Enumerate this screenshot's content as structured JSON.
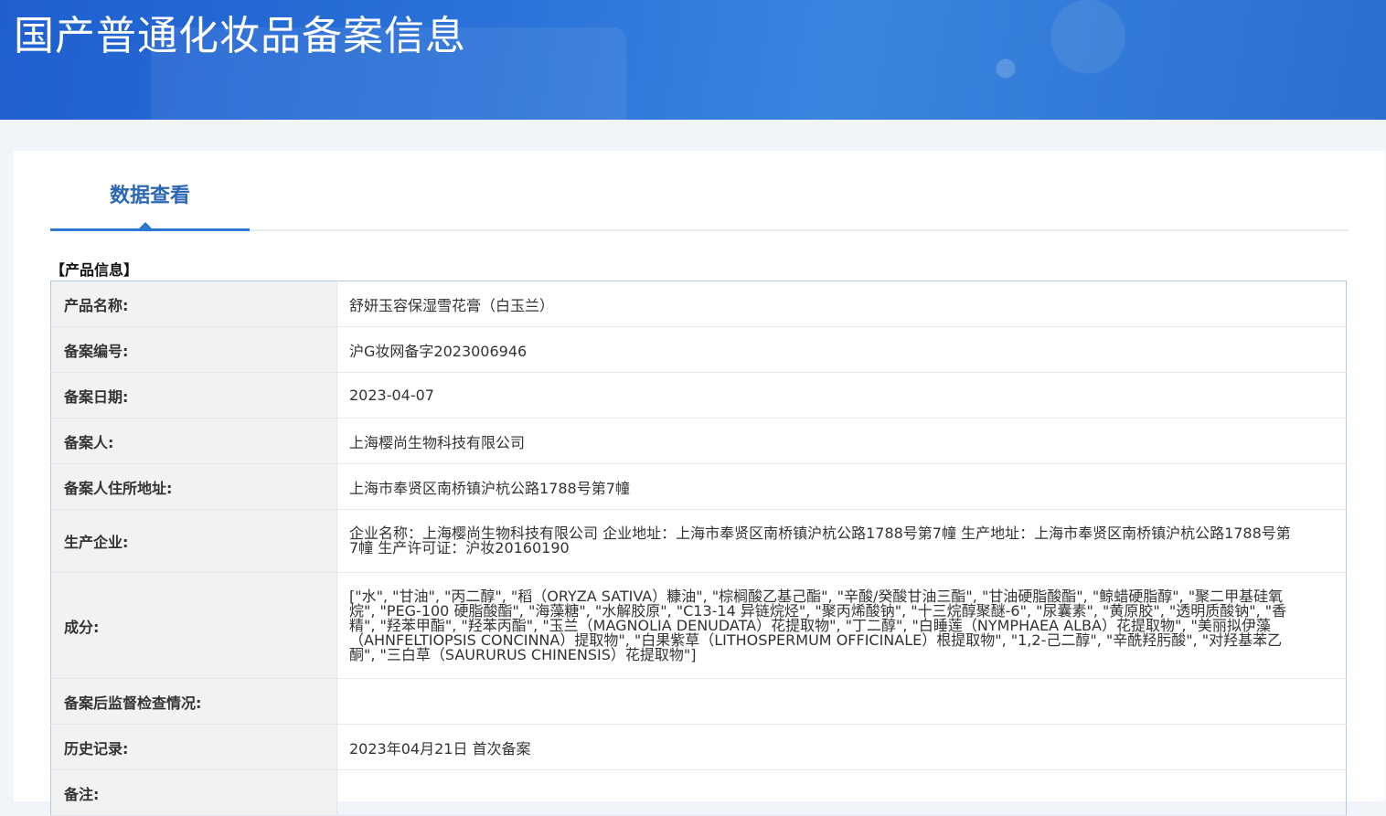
{
  "banner": {
    "title": "国产普通化妆品备案信息"
  },
  "tabs": {
    "active_label": "数据查看"
  },
  "section": {
    "title": "【产品信息】"
  },
  "rows": [
    {
      "label": "产品名称:",
      "value": "舒妍玉容保湿雪花膏（白玉兰）"
    },
    {
      "label": "备案编号:",
      "value": "沪G妆网备字2023006946"
    },
    {
      "label": "备案日期:",
      "value": "2023-04-07"
    },
    {
      "label": "备案人:",
      "value": "上海樱尚生物科技有限公司"
    },
    {
      "label": "备案人住所地址:",
      "value": "上海市奉贤区南桥镇沪杭公路1788号第7幢"
    },
    {
      "label": "生产企业:",
      "value": "企业名称：上海樱尚生物科技有限公司 企业地址：上海市奉贤区南桥镇沪杭公路1788号第7幢 生产地址：上海市奉贤区南桥镇沪杭公路1788号第7幢 生产许可证：沪妆20160190"
    },
    {
      "label": "成分:",
      "value": "[\"水\", \"甘油\", \"丙二醇\", \"稻（ORYZA SATIVA）糠油\", \"棕榈酸乙基己酯\", \"辛酸/癸酸甘油三酯\", \"甘油硬脂酸酯\", \"鲸蜡硬脂醇\", \"聚二甲基硅氧烷\", \"PEG-100 硬脂酸酯\", \"海藻糖\", \"水解胶原\", \"C13-14 异链烷烃\", \"聚丙烯酸钠\", \"十三烷醇聚醚-6\", \"尿囊素\", \"黄原胶\", \"透明质酸钠\", \"香精\", \"羟苯甲酯\", \"羟苯丙酯\", \"玉兰（MAGNOLIA DENUDATA）花提取物\", \"丁二醇\", \"白睡莲（NYMPHAEA ALBA）花提取物\", \"美丽拟伊藻（AHNFELTIOPSIS CONCINNA）提取物\", \"白果紫草（LITHOSPERMUM OFFICINALE）根提取物\", \"1,2-己二醇\", \"辛酰羟肟酸\", \"对羟基苯乙酮\", \"三白草（SAURURUS CHINENSIS）花提取物\"]"
    },
    {
      "label": "备案后监督检查情况:",
      "value": ""
    },
    {
      "label": "历史记录:",
      "value": "2023年04月21日 首次备案"
    },
    {
      "label": "备注:",
      "value": ""
    }
  ]
}
